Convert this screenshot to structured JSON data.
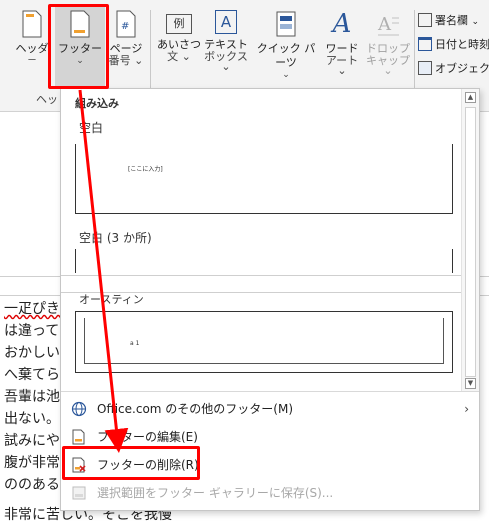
{
  "ribbon": {
    "header_button": {
      "line1": "ヘッダ",
      "line2": "ー"
    },
    "footer_button": {
      "label": "フッター",
      "chevron": "⌄"
    },
    "page_number_button": {
      "line1": "ページ",
      "line2": "番号 ⌄"
    },
    "group_label": "ヘッ",
    "greeting_button": {
      "line1": "あいさつ",
      "line2": "文 ⌄",
      "icon_text": "例"
    },
    "textbox_button": {
      "line1": "テキスト",
      "line2": "ボックス ⌄",
      "icon_text": "A"
    },
    "quickparts_button": {
      "line1": "クイック パーツ",
      "line2": "⌄"
    },
    "wordart_button": {
      "line1": "ワード",
      "line2": "アート ⌄"
    },
    "dropcap_button": {
      "line1": "ドロップ",
      "line2": "キャップ ⌄"
    },
    "signature_line": "署名欄",
    "date_time": "日付と時刻",
    "object": "オブジェクト"
  },
  "document": {
    "lines": [
      "一疋ぴきも",
      "は違って",
      "おかしいと",
      "へ棄てら",
      "吾輩は池",
      "出ない。し",
      "試みにや",
      "腹が非常",
      "ののある",
      "非常に苦しい。そこを我慢"
    ]
  },
  "gallery": {
    "heading": "組み込み",
    "templates": [
      {
        "name": "空白",
        "placeholder": "[ここに入力]"
      },
      {
        "name": "空白 (3 か所)"
      },
      {
        "name": "オースティン",
        "placeholder": "a 1"
      }
    ]
  },
  "menu": {
    "items": [
      {
        "label": "Office.com のその他のフッター(M)",
        "has_submenu": true,
        "disabled": false
      },
      {
        "label": "フッターの編集(E)",
        "disabled": false
      },
      {
        "label": "フッターの削除(R)",
        "disabled": false
      },
      {
        "label": "選択範囲をフッター ギャラリーに保存(S)...",
        "disabled": true
      }
    ]
  },
  "colors": {
    "highlight": "#ff0000",
    "accent_blue": "#2b579a",
    "ribbon_bg": "#f3f3f3"
  }
}
